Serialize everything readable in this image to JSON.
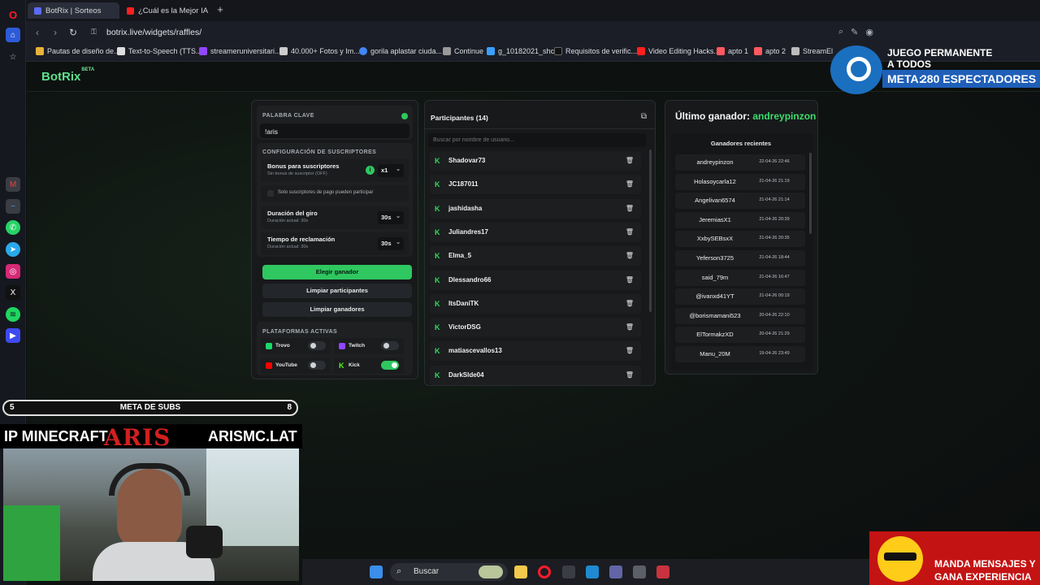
{
  "browser": {
    "tabs": [
      {
        "label": "BotRix | Sorteos",
        "active": true
      },
      {
        "label": "¿Cuál es la Mejor IA para",
        "active": false
      }
    ],
    "url": "botrix.live/widgets/raffles/",
    "bookmarks": [
      "Pautas de diseño de...",
      "Text-to-Speech (TTS...",
      "streameruniversitari...",
      "40.000+ Fotos y Im...",
      "gorila aplastar ciuda...",
      "Continue",
      "g_10182021_shcc",
      "Requisitos de verific...",
      "Video Editing Hacks...",
      "apto 1",
      "apto 2",
      "StreamEl"
    ]
  },
  "app": {
    "logo": "BotRix",
    "logo_badge": "BETA"
  },
  "settings": {
    "keyword_label": "PALABRA CLAVE",
    "keyword_value": "!aris",
    "subs_section_title": "CONFIGURACIÓN DE SUSCRIPTORES",
    "bonus_title": "Bonus para suscriptores",
    "bonus_sub": "Sin bonus de suscriptor (OFF)",
    "bonus_value": "x1",
    "paid_only_label": "Solo suscriptores de pago pueden participar",
    "spin_title": "Duración del giro",
    "spin_sub": "Duración actual: 30s",
    "spin_value": "30s",
    "claim_title": "Tiempo de reclamación",
    "claim_sub": "Duración actual: 30s",
    "claim_value": "30s",
    "pick_winner": "Elegir ganador",
    "clear_participants": "Limpiar participantes",
    "clear_winners": "Limpiar ganadores",
    "platforms_title": "PLATAFORMAS ACTIVAS",
    "platforms": [
      {
        "name": "Trovo",
        "enabled": false,
        "color": "#1bd96a"
      },
      {
        "name": "Twitch",
        "enabled": false,
        "color": "#9146ff"
      },
      {
        "name": "YouTube",
        "enabled": false,
        "color": "#ff0000"
      },
      {
        "name": "Kick",
        "enabled": true,
        "color": "#53fc18"
      }
    ]
  },
  "participants": {
    "title": "Participantes (14)",
    "search_placeholder": "Buscar por nombre de usuario...",
    "list": [
      "Shadovar73",
      "JC187011",
      "jashidasha",
      "Juliandres17",
      "Elma_5",
      "Dlessandro66",
      "ItsDaniTK",
      "VictorDSG",
      "matiascevallos13",
      "DarkSlde04"
    ]
  },
  "winners": {
    "last_label": "Último ganador:",
    "last_name": "andreypinzon",
    "recent_title": "Ganadores recientes",
    "list": [
      {
        "name": "andreypinzon",
        "date": "22-04-26 22:46"
      },
      {
        "name": "Holasoycarla12",
        "date": "21-04-26 21:19"
      },
      {
        "name": "Angelivan6574",
        "date": "21-04-26 21:14"
      },
      {
        "name": "JeremiasX1",
        "date": "21-04-26 20:39"
      },
      {
        "name": "XxbySEBsxX",
        "date": "21-04-26 20:35"
      },
      {
        "name": "Yeferson3725",
        "date": "21-04-26 18:44"
      },
      {
        "name": "said_79m",
        "date": "21-04-26 16:47"
      },
      {
        "name": "@ivanxd41YT",
        "date": "21-04-26 00:19"
      },
      {
        "name": "@borismamani523",
        "date": "20-04-26 22:10"
      },
      {
        "name": "ElTormakzXD",
        "date": "20-04-26 21:29"
      },
      {
        "name": "Manu_20M",
        "date": "19-04-26 23:49"
      }
    ]
  },
  "overlay": {
    "subs_start": "5",
    "subs_label": "META DE SUBS",
    "subs_goal": "8",
    "ip_label": "IP MINECRAFT",
    "ip_name": "ARIS",
    "ip_server": "ARISMC.LAT",
    "steam_line1": "JUEGO PERMANENTE",
    "steam_line2": "A TODOS",
    "steam_meta_label": "META:",
    "steam_meta_value": "280 ESPECTADORES",
    "msg_line1": "MANDA MENSAJES Y",
    "msg_line2": "GANA EXPERIENCIA"
  },
  "taskbar": {
    "search_label": "Buscar"
  }
}
